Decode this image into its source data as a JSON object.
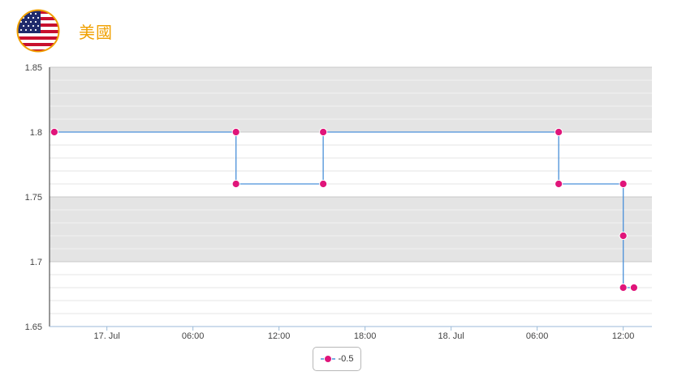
{
  "header": {
    "flag_icon": "us-flag-icon",
    "team_name": "美國"
  },
  "colors": {
    "line": "#4a90d9",
    "marker": "#e0157a",
    "band": "#e4e4e4",
    "title": "#f0a000"
  },
  "chart_data": {
    "type": "line",
    "step": true,
    "title": "",
    "xlabel": "",
    "ylabel": "",
    "ylim": [
      1.65,
      1.85
    ],
    "yticks": [
      "1.65",
      "1.7",
      "1.75",
      "1.8",
      "1.85"
    ],
    "xlim": [
      "07-16 20:00",
      "07-18 14:00"
    ],
    "xticks": [
      {
        "label": "17. Jul",
        "t": "07-17 00:00"
      },
      {
        "label": "06:00",
        "t": "07-17 06:00"
      },
      {
        "label": "12:00",
        "t": "07-17 12:00"
      },
      {
        "label": "18:00",
        "t": "07-17 18:00"
      },
      {
        "label": "18. Jul",
        "t": "07-18 00:00"
      },
      {
        "label": "06:00",
        "t": "07-18 06:00"
      },
      {
        "label": "12:00",
        "t": "07-18 12:00"
      }
    ],
    "legend": "bottom-center",
    "series": [
      {
        "name": "-0.5",
        "points": [
          {
            "t": "07-16 20:20",
            "y": 1.8
          },
          {
            "t": "07-17 09:00",
            "y": 1.8
          },
          {
            "t": "07-17 09:00",
            "y": 1.76
          },
          {
            "t": "07-17 15:05",
            "y": 1.76
          },
          {
            "t": "07-17 15:05",
            "y": 1.8
          },
          {
            "t": "07-18 07:30",
            "y": 1.8
          },
          {
            "t": "07-18 07:30",
            "y": 1.76
          },
          {
            "t": "07-18 12:00",
            "y": 1.76
          },
          {
            "t": "07-18 12:00",
            "y": 1.72
          },
          {
            "t": "07-18 12:00",
            "y": 1.68
          },
          {
            "t": "07-18 12:45",
            "y": 1.68
          }
        ]
      }
    ]
  }
}
